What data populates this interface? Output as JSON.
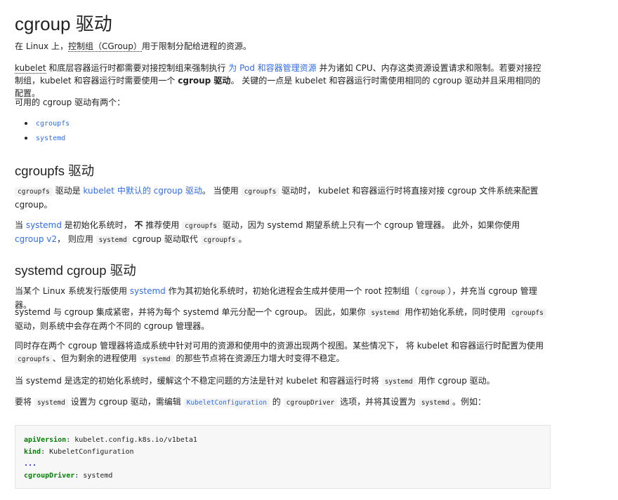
{
  "title": "cgroup 驱动",
  "intro": {
    "prefix": "在 Linux 上，",
    "glossary_term": "控制组（CGroup）",
    "suffix": "用于限制分配给进程的资源。"
  },
  "para_kubelet": {
    "kubelet_term": "kubelet",
    "text1": " 和底层容器运行时都需要对接控制组来强制执行 ",
    "link": "为 Pod 和容器管理资源",
    "text2": " 并为诸如 CPU、内存这类资源设置请求和限制。若要对接控制组，kubelet 和容器运行时需要使用一个 ",
    "bold": "cgroup 驱动",
    "text3": "。 关键的一点是 kubelet 和容器运行时需使用相同的 cgroup 驱动并且采用相同的配置。"
  },
  "drivers_intro": "可用的 cgroup 驱动有两个：",
  "drivers": [
    {
      "label": "cgroupfs"
    },
    {
      "label": "systemd"
    }
  ],
  "section_cgroupfs": {
    "heading": "cgroupfs 驱动",
    "p1": {
      "code1": "cgroupfs",
      "t1": " 驱动是 ",
      "link": "kubelet 中默认的 cgroup 驱动",
      "t2": "。 当使用 ",
      "code2": "cgroupfs",
      "t3": " 驱动时， kubelet 和容器运行时将直接对接 cgroup 文件系统来配置 cgroup。"
    },
    "p2": {
      "t1": "当 ",
      "link1": "systemd",
      "t2": " 是初始化系统时， ",
      "bold": "不",
      "t3": " 推荐使用 ",
      "code1": "cgroupfs",
      "t4": " 驱动，因为 systemd 期望系统上只有一个 cgroup 管理器。 此外，如果你使用 ",
      "link2": "cgroup v2",
      "t5": "， 则应用 ",
      "code2": "systemd",
      "t6": " cgroup 驱动取代 ",
      "code3": "cgroupfs",
      "t7": "。"
    }
  },
  "section_systemd": {
    "heading": "systemd cgroup 驱动",
    "p1": {
      "t1": "当某个 Linux 系统发行版使用 ",
      "link": "systemd",
      "t2": " 作为其初始化系统时，初始化进程会生成并使用一个 root 控制组（",
      "code": "cgroup",
      "t3": "），并充当 cgroup 管理器。"
    },
    "p2": {
      "t1": "systemd 与 cgroup 集成紧密，并将为每个 systemd 单元分配一个 cgroup。 因此，如果你 ",
      "code1": "systemd",
      "t2": " 用作初始化系统，同时使用 ",
      "code2": "cgroupfs",
      "t3": " 驱动，则系统中会存在两个不同的 cgroup 管理器。"
    },
    "p3": {
      "t1": "同时存在两个 cgroup 管理器将造成系统中针对可用的资源和使用中的资源出现两个视图。某些情况下， 将 kubelet 和容器运行时配置为使用 ",
      "code1": "cgroupfs",
      "t2": "、但为剩余的进程使用 ",
      "code2": "systemd",
      "t3": " 的那些节点将在资源压力增大时变得不稳定。"
    },
    "p4": {
      "t1": "当 systemd 是选定的初始化系统时，缓解这个不稳定问题的方法是针对 kubelet 和容器运行时将 ",
      "code": "systemd",
      "t2": " 用作 cgroup 驱动。"
    },
    "p5": {
      "t1": "要将 ",
      "code1": "systemd",
      "t2": " 设置为 cgroup 驱动，需编辑 ",
      "code_link": "KubeletConfiguration",
      "t3": " 的 ",
      "code2": "cgroupDriver",
      "t4": " 选项，并将其设置为 ",
      "code3": "systemd",
      "t5": "。例如："
    }
  },
  "code_block": {
    "lines": [
      {
        "key": "apiVersion",
        "value": " kubelet.config.k8s.io/v1beta1"
      },
      {
        "key": "kind",
        "value": " KubeletConfiguration"
      },
      {
        "dots": "..."
      },
      {
        "key": "cgroupDriver",
        "value": " systemd"
      }
    ]
  }
}
